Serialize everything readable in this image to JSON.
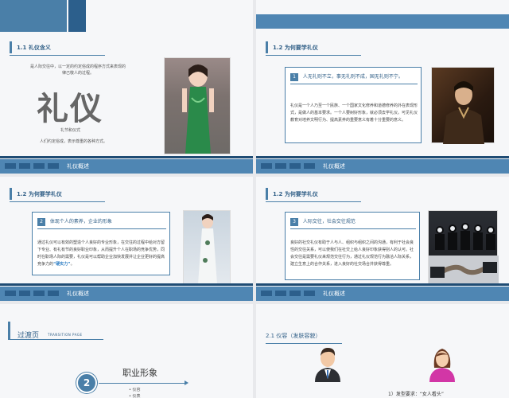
{
  "slide1": {
    "section": "1.1  礼仪含义",
    "quote": "是人际交往中，以一定的约定俗成的程序方式来表现的律己敬人的过程。",
    "big_title": "礼仪",
    "caption1": "礼节和仪式",
    "caption2": "人们约定俗成，表示尊重的各种方式。",
    "footer": "礼仪概述"
  },
  "slide2": {
    "section": "1.2 为何要学礼仪",
    "box_num": "1",
    "box_title": "人无礼则不立，事无礼则不成，国无礼则不宁。",
    "body": "礼仪是一个人乃至一个民族、一个国家文化修养和道德修养的外在表现形式，是做人的基本要求。一个人要树好形象，就必须去学礼仪。可见礼仪教育对培养文明行为、提高素养的重要意义有着十分重要的意义。",
    "highlight": "学礼仪",
    "footer": "礼仪概述"
  },
  "slide3": {
    "section": "1.2 为何要学礼仪",
    "box_num": "2",
    "box_title": "体现个人的素养，企业的形象",
    "body": "通过礼仪可以有效的塑造个人良好的专业形象，在交往的过程中给对方留下专业、有礼有节的良好职业印象，从而提升个人在职场的竞争优势，同时在职场人际的需要，礼仪是可以帮助企业加快发展并让企业更好的提高竞争力的",
    "highlight": "“硬实力”",
    "footer": "礼仪概述"
  },
  "slide4": {
    "section": "1.2 为何要学礼仪",
    "box_num": "3",
    "box_title": "人际交往，社会交往规范",
    "body": "良好的社交礼仪有助于人与人、组织与组织之间的沟通，有利于社会良性的交往关系，可以使我们在社交上给人良好印象获得别人的认可。社会交往是需要礼仪来规范交往行为，通过礼仪规范行为融洽人际关系，建立生意上的合作关系，进入良好的社交场合并获得尊重。",
    "footer": "礼仪概述"
  },
  "slide5": {
    "title": "过渡页",
    "subtitle": "TRANSITION PAGE",
    "num": "2",
    "heading": "职业形象",
    "item1": "仪容",
    "item2": "仪表"
  },
  "slide6": {
    "section": "2.1  仪容（发肤容貌）",
    "caption": "1）发型要求：“女人看头”"
  },
  "colors": {
    "accent": "#4a7fa8",
    "dark": "#1f4c74",
    "footer": "#4f86b3"
  }
}
